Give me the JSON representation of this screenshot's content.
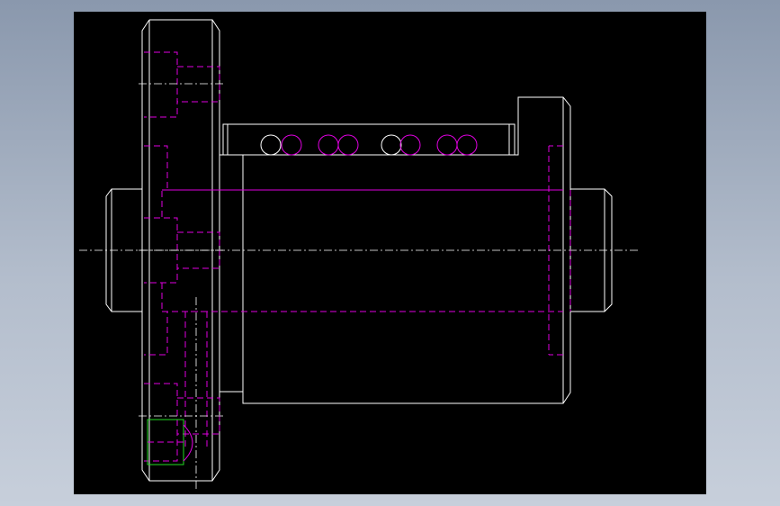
{
  "drawing": {
    "subject": "",
    "colors": {
      "background": "#000000",
      "visible_edge": "#ffffff",
      "hidden_edge": "#e000e0",
      "selection": "#22dd22",
      "frame_gradient_top": "#8a98ad",
      "frame_gradient_bottom": "#c7cfdb"
    }
  }
}
